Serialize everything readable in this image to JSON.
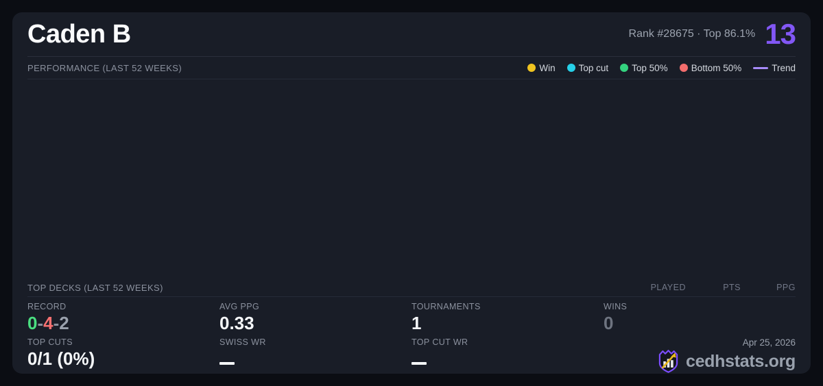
{
  "header": {
    "player_name": "Caden B",
    "rank_text": "Rank #28675  ·  Top 86.1%",
    "score": "13"
  },
  "performance": {
    "title": "PERFORMANCE (LAST 52 WEEKS)",
    "legend": [
      {
        "label": "Win",
        "color": "#f0c420",
        "swatch": "dot"
      },
      {
        "label": "Top cut",
        "color": "#26d0e8",
        "swatch": "dot"
      },
      {
        "label": "Top 50%",
        "color": "#34d37f",
        "swatch": "dot"
      },
      {
        "label": "Bottom 50%",
        "color": "#f36d6d",
        "swatch": "dot"
      },
      {
        "label": "Trend",
        "color": "#a78bfa",
        "swatch": "line"
      }
    ]
  },
  "chart_data": {
    "type": "scatter",
    "title": "PERFORMANCE (LAST 52 WEEKS)",
    "points": [],
    "note": "chart plot area is empty in screenshot - no data points, axes or gridlines rendered"
  },
  "top_decks": {
    "title": "TOP DECKS (LAST 52 WEEKS)",
    "columns": [
      "PLAYED",
      "PTS",
      "PPG"
    ],
    "rows": []
  },
  "stats": {
    "record": {
      "label": "RECORD",
      "wins": "0",
      "losses": "4",
      "draws": "2",
      "separator": "-"
    },
    "avg_ppg": {
      "label": "AVG PPG",
      "value": "0.33"
    },
    "tournaments": {
      "label": "TOURNAMENTS",
      "value": "1"
    },
    "wins": {
      "label": "WINS",
      "value": "0"
    },
    "top_cuts": {
      "label": "TOP CUTS",
      "value": "0/1 (0%)"
    },
    "swiss_wr": {
      "label": "SWISS WR",
      "value": "—"
    },
    "top_cut_wr": {
      "label": "TOP CUT WR",
      "value": "—"
    }
  },
  "footer": {
    "date": "Apr 25, 2026",
    "brand": "cedhstats.org",
    "logo": "shield-chart-arrow-icon"
  },
  "colors": {
    "page_bg": "#0b0d13",
    "card_bg": "#191d27",
    "border": "#2a2f3c",
    "accent_purple": "#8257f5",
    "win_green": "#4ade80",
    "loss_red": "#f87171",
    "muted_gray": "#8b919e",
    "logo_purple": "#7c4dff",
    "logo_gold": "#e8b820"
  }
}
